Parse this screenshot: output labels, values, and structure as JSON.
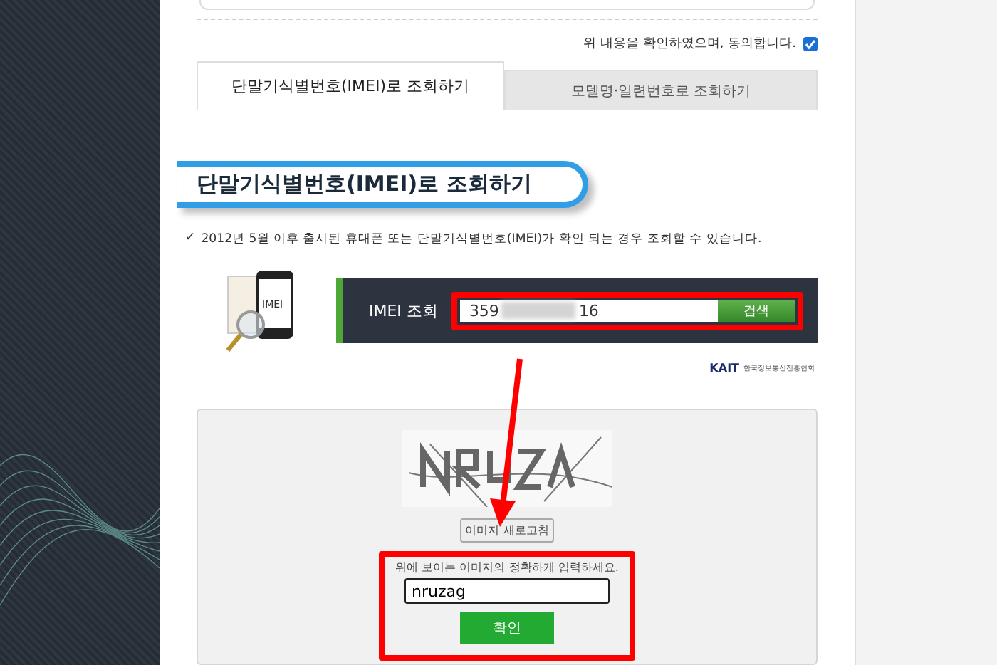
{
  "agreement": {
    "label": "위 내용을 확인하였으며, 동의합니다.",
    "checked": true
  },
  "tabs": [
    {
      "label": "단말기식별번호(IMEI)로 조회하기",
      "selected": true
    },
    {
      "label": "모델명·일련번호로 조회하기",
      "selected": false
    }
  ],
  "section_title": "단말기식별번호(IMEI)로 조회하기",
  "note": {
    "mark": "✓",
    "text": "2012년 5월 이후 출시된 휴대폰 또는 단말기식별번호(IMEI)가 확인 되는 경우 조회할 수 있습니다."
  },
  "imei_panel": {
    "phone_label": "IMEI",
    "label": "IMEI 조회",
    "value_start": "359",
    "value_end": "16",
    "button": "검색"
  },
  "kait_logo": {
    "name": "KAIT",
    "subtitle": "한국정보통신진흥협회"
  },
  "captcha": {
    "refresh_button": "이미지 새로고침",
    "instruction": "위에 보이는 이미지의 정확하게 입력하세요.",
    "value": "nruzag",
    "confirm_button": "확인"
  }
}
